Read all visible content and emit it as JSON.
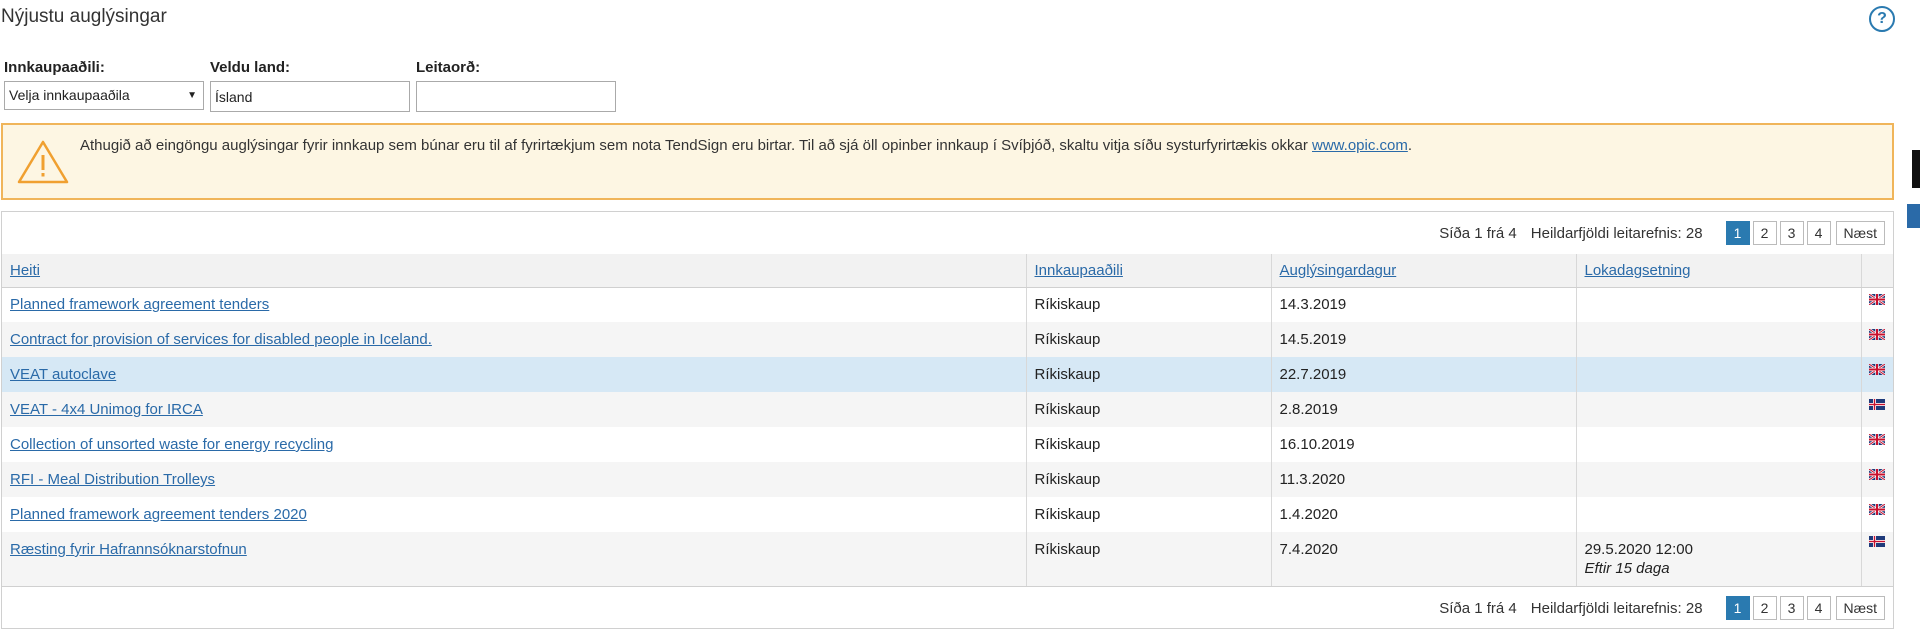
{
  "page": {
    "title": "Nýjustu auglýsingar",
    "help_label": "?"
  },
  "filters": {
    "buyer_label": "Innkaupaaðili:",
    "buyer_value": "Velja innkaupaaðila",
    "country_label": "Veldu land:",
    "country_value": "Ísland",
    "search_label": "Leitaorð:",
    "search_value": ""
  },
  "notice": {
    "text": "Athugið að eingöngu auglýsingar fyrir innkaup sem búnar eru til af fyrirtækjum sem nota TendSign eru birtar. Til að sjá öll opinber innkaup í Svíþjóð, skaltu vitja síðu systurfyrirtækis okkar ",
    "link": "www.opic.com",
    "suffix": "."
  },
  "pager": {
    "page_info": "Síða 1 frá 4",
    "total": "Heildarfjöldi leitarefnis: 28",
    "pages": [
      "1",
      "2",
      "3",
      "4"
    ],
    "next": "Næst"
  },
  "table": {
    "headers": {
      "title": "Heiti",
      "buyer": "Innkaupaaðili",
      "published": "Auglýsingardagur",
      "deadline": "Lokadagsetning"
    },
    "rows": [
      {
        "title": "Planned framework agreement tenders",
        "buyer": "Ríkiskaup",
        "published": "14.3.2019",
        "deadline": "",
        "deadline_note": "",
        "flag": "uk-flag-icon"
      },
      {
        "title": "Contract for provision of services for disabled people in Iceland.",
        "buyer": "Ríkiskaup",
        "published": "14.5.2019",
        "deadline": "",
        "deadline_note": "",
        "flag": "uk-flag-icon"
      },
      {
        "title": "VEAT autoclave",
        "buyer": "Ríkiskaup",
        "published": "22.7.2019",
        "deadline": "",
        "deadline_note": "",
        "flag": "uk-flag-icon"
      },
      {
        "title": "VEAT - 4x4 Unimog for IRCA",
        "buyer": "Ríkiskaup",
        "published": "2.8.2019",
        "deadline": "",
        "deadline_note": "",
        "flag": "iceland-flag-icon"
      },
      {
        "title": "Collection of unsorted waste for energy recycling",
        "buyer": "Ríkiskaup",
        "published": "16.10.2019",
        "deadline": "",
        "deadline_note": "",
        "flag": "uk-flag-icon"
      },
      {
        "title": "RFI - Meal Distribution Trolleys",
        "buyer": "Ríkiskaup",
        "published": "11.3.2020",
        "deadline": "",
        "deadline_note": "",
        "flag": "uk-flag-icon"
      },
      {
        "title": "Planned framework agreement tenders 2020",
        "buyer": "Ríkiskaup",
        "published": "1.4.2020",
        "deadline": "",
        "deadline_note": "",
        "flag": "uk-flag-icon"
      },
      {
        "title": "Ræsting fyrir Hafrannsóknarstofnun",
        "buyer": "Ríkiskaup",
        "published": "7.4.2020",
        "deadline": "29.5.2020 12:00",
        "deadline_note": "Eftir 15 daga",
        "flag": "iceland-flag-icon"
      }
    ]
  },
  "colors": {
    "accent": "#2a7ab0",
    "link": "#2a6aa8",
    "notice_border": "#f0b55a",
    "notice_bg": "#fdf6e3",
    "selected_row": "#d6e8f5"
  }
}
